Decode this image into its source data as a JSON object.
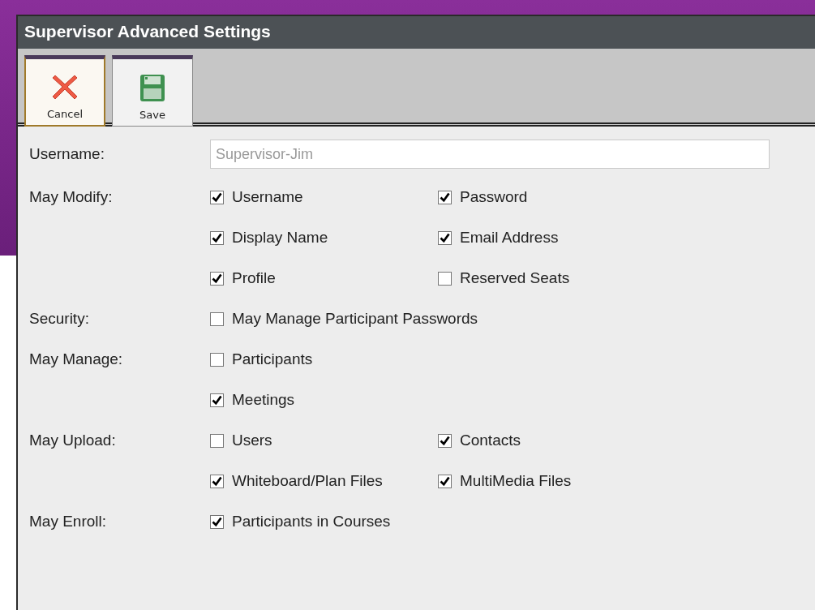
{
  "window": {
    "title": "Supervisor Advanced Settings"
  },
  "toolbar": [
    {
      "kind": "cancel",
      "label": "Cancel",
      "selected": true
    },
    {
      "kind": "save",
      "label": "Save",
      "selected": false
    }
  ],
  "username": {
    "label": "Username:",
    "value": "Supervisor-Jim",
    "disabled": true
  },
  "groups": [
    {
      "label": "May Modify:",
      "rows": [
        [
          {
            "label": "Username",
            "checked": true
          },
          {
            "label": "Password",
            "checked": true
          }
        ],
        [
          {
            "label": "Display Name",
            "checked": true
          },
          {
            "label": "Email Address",
            "checked": true
          }
        ],
        [
          {
            "label": "Profile",
            "checked": true
          },
          {
            "label": "Reserved Seats",
            "checked": false
          }
        ]
      ]
    },
    {
      "label": "Security:",
      "rows": [
        [
          {
            "label": "May Manage Participant Passwords",
            "checked": false
          }
        ]
      ]
    },
    {
      "label": "May Manage:",
      "rows": [
        [
          {
            "label": "Participants",
            "checked": false
          }
        ],
        [
          {
            "label": "Meetings",
            "checked": true
          }
        ]
      ]
    },
    {
      "label": "May Upload:",
      "rows": [
        [
          {
            "label": "Users",
            "checked": false
          },
          {
            "label": "Contacts",
            "checked": true
          }
        ],
        [
          {
            "label": "Whiteboard/Plan Files",
            "checked": true
          },
          {
            "label": "MultiMedia Files",
            "checked": true
          }
        ]
      ]
    },
    {
      "label": "May Enroll:",
      "rows": [
        [
          {
            "label": "Participants in Courses",
            "checked": true
          }
        ]
      ]
    }
  ]
}
